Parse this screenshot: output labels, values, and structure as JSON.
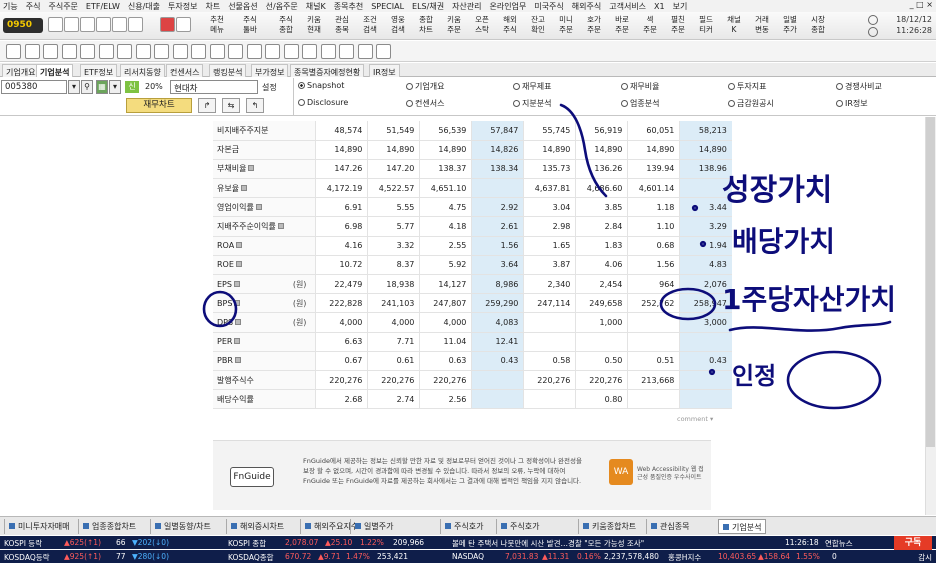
{
  "menu": {
    "items": [
      "기능",
      "주식",
      "주식주문",
      "ETF/ELW",
      "신용/대출",
      "투자정보",
      "차트",
      "선물옵션",
      "선/옵주문",
      "채널K",
      "종목추천",
      "SPECIAL",
      "ELS/채권",
      "자산관리",
      "온라인업무",
      "미국주식",
      "해외주식",
      "고객서비스",
      "X1",
      "보기"
    ],
    "window_controls": "_ □ ×"
  },
  "toolbar": {
    "code": "0950",
    "buttons": [
      "추천\n메뉴",
      "주식\n툴바",
      "주식\n종합",
      "키움\n현재",
      "관심\n종목",
      "조건\n검색",
      "영웅\n검색",
      "종합\n차트",
      "키움\n주문",
      "오픈\n스탁",
      "해외\n주식",
      "잔고\n확인",
      "미니\n주문",
      "호가\n주문",
      "바로\n주문",
      "섹\n주문",
      "펼친\n주문",
      "필드\n티커",
      "채널\nK",
      "거래\n변동",
      "일별\n주가",
      "시장\n종합"
    ],
    "date": "18/12/12",
    "time": "11:26:28"
  },
  "tabs": [
    "기업개요",
    "기업분석",
    "ETF정보",
    "리서치동향",
    "컨센서스",
    "랭킹분석",
    "부가정보",
    "종목별증자예정현황",
    "IR정보"
  ],
  "active_tab": "기업분석",
  "controls": {
    "stock_code": "005380",
    "sin_label": "신",
    "percent": "20%",
    "stock_name": "현대차",
    "settings": "설정",
    "fin_chart_button": "재무차트",
    "radios": [
      {
        "label": "Snapshot",
        "on": true
      },
      {
        "label": "기업개요",
        "on": false
      },
      {
        "label": "재무제표",
        "on": false
      },
      {
        "label": "재무비율",
        "on": false
      },
      {
        "label": "투자지표",
        "on": false
      },
      {
        "label": "경쟁사비교",
        "on": false
      },
      {
        "label": "Disclosure",
        "on": false
      },
      {
        "label": "컨센서스",
        "on": false
      },
      {
        "label": "지분분석",
        "on": false
      },
      {
        "label": "업종분석",
        "on": false
      },
      {
        "label": "금감원공시",
        "on": false
      },
      {
        "label": "IR정보",
        "on": false
      }
    ]
  },
  "table": {
    "rows": [
      {
        "label": "비지배주주지분",
        "unit": "",
        "values": [
          "48,574",
          "51,549",
          "56,539",
          "57,847",
          "55,745",
          "56,919",
          "60,051",
          "58,213"
        ]
      },
      {
        "label": "자본금",
        "unit": "",
        "values": [
          "14,890",
          "14,890",
          "14,890",
          "14,826",
          "14,890",
          "14,890",
          "14,890",
          "14,890"
        ]
      },
      {
        "label": "부채비율",
        "unit": "",
        "values": [
          "147.26",
          "147.20",
          "138.37",
          "138.34",
          "135.73",
          "136.26",
          "139.94",
          "138.96"
        ]
      },
      {
        "label": "유보율",
        "unit": "",
        "values": [
          "4,172.19",
          "4,522.57",
          "4,651.10",
          "",
          "4,637.81",
          "4,686.60",
          "4,601.14",
          ""
        ]
      },
      {
        "label": "영업이익률",
        "unit": "",
        "values": [
          "6.91",
          "5.55",
          "4.75",
          "2.92",
          "3.04",
          "3.85",
          "1.18",
          "3.44"
        ]
      },
      {
        "label": "지배주주순이익률",
        "unit": "",
        "values": [
          "6.98",
          "5.77",
          "4.18",
          "2.61",
          "2.98",
          "2.84",
          "1.10",
          "3.29"
        ]
      },
      {
        "label": "ROA",
        "unit": "",
        "values": [
          "4.16",
          "3.32",
          "2.55",
          "1.56",
          "1.65",
          "1.83",
          "0.68",
          "1.94"
        ]
      },
      {
        "label": "ROE",
        "unit": "",
        "values": [
          "10.72",
          "8.37",
          "5.92",
          "3.64",
          "3.87",
          "4.06",
          "1.56",
          "4.83"
        ]
      },
      {
        "label": "EPS",
        "unit": "(원)",
        "values": [
          "22,479",
          "18,938",
          "14,127",
          "8,986",
          "2,340",
          "2,454",
          "964",
          "2,076"
        ]
      },
      {
        "label": "BPS",
        "unit": "(원)",
        "values": [
          "222,828",
          "241,103",
          "247,807",
          "259,290",
          "247,114",
          "249,658",
          "252,762",
          "258,947"
        ]
      },
      {
        "label": "DPS",
        "unit": "(원)",
        "values": [
          "4,000",
          "4,000",
          "4,000",
          "4,083",
          "",
          "1,000",
          "",
          "3,000"
        ]
      },
      {
        "label": "PER",
        "unit": "",
        "values": [
          "6.63",
          "7.71",
          "11.04",
          "12.41",
          "",
          "",
          "",
          ""
        ]
      },
      {
        "label": "PBR",
        "unit": "",
        "values": [
          "0.67",
          "0.61",
          "0.63",
          "0.43",
          "0.58",
          "0.50",
          "0.51",
          "0.43"
        ]
      },
      {
        "label": "발행주식수",
        "unit": "",
        "values": [
          "220,276",
          "220,276",
          "220,276",
          "",
          "220,276",
          "220,276",
          "213,668",
          ""
        ]
      },
      {
        "label": "배당수익률",
        "unit": "",
        "values": [
          "2.68",
          "2.74",
          "2.56",
          "",
          "",
          "0.80",
          "",
          ""
        ]
      }
    ],
    "more_text": "comment ▾"
  },
  "footer": {
    "fnguide_logo": "FnGuide",
    "disclaimer": "FnGuide에서 제공하는 정보는 신뢰할 만한 자료 및 정보로부터 얻어진 것이나 그 정확성이나 완전성을 보장 할 수 없으며, 시간이 경과함에 따라 변경될 수 있습니다. 따라서 정보의 오류, 누락에 대하여 FnGuide 또는 FnGuide에 자료를 제공하는 회사에서는 그 결과에 대해 법적인 책임을 지지 않습니다.",
    "wa_logo": "WA",
    "wa_text": "Web Accessibility 웹 접근성 품질인증 우수사이트"
  },
  "annotations": {
    "ink_color": "#0d0d7a",
    "line1": "성장가치",
    "line2": "배당가치",
    "line3": "1주당자산가치",
    "line4": "인정"
  },
  "bottom_tabs": [
    "미니투자자매매",
    "업종종합차트",
    "일별동향/차트",
    "해외증시차트",
    "해외주요지수",
    "일별주가",
    "주식호가",
    "주식호가",
    "키움종합차트",
    "관심종목",
    "기업분석"
  ],
  "ticker1": {
    "label": "KOSPI 등락",
    "up": "▲625(↑1)",
    "same": "66",
    "down": "▼202(↓0)",
    "index_name": "KOSPI 종합",
    "index_value": "2,078.07",
    "index_chg": "▲25.10",
    "index_pct": "1.22%",
    "volume": "209,966",
    "news": "볼메 탄 주택서 나뭇만에 시산 발견…경찰 \"모든 가능성 조사\"",
    "time": "11:26:18",
    "news_source": "연합뉴스",
    "button": "구독"
  },
  "ticker2": {
    "label": "KOSDAQ등락",
    "up": "▲925(↑1)",
    "same": "77",
    "down": "▼280(↓0)",
    "index_name": "KOSDAQ종합",
    "index_value": "670.72",
    "index_chg": "▲9.71",
    "index_pct": "1.47%",
    "volume": "253,421",
    "nasdaq_label": "NASDAQ",
    "nasdaq_value": "7,031.83",
    "nasdaq_chg": "▲11.31",
    "nasdaq_pct": "0.16%",
    "nasdaq_vol": "2,237,578,480",
    "hangseng_label": "홍콩H지수",
    "hangseng_value": "10,403.65",
    "hangseng_chg": "▲158.64",
    "hangseng_pct": "1.55%",
    "misc": "0",
    "gamsi": "감시"
  }
}
